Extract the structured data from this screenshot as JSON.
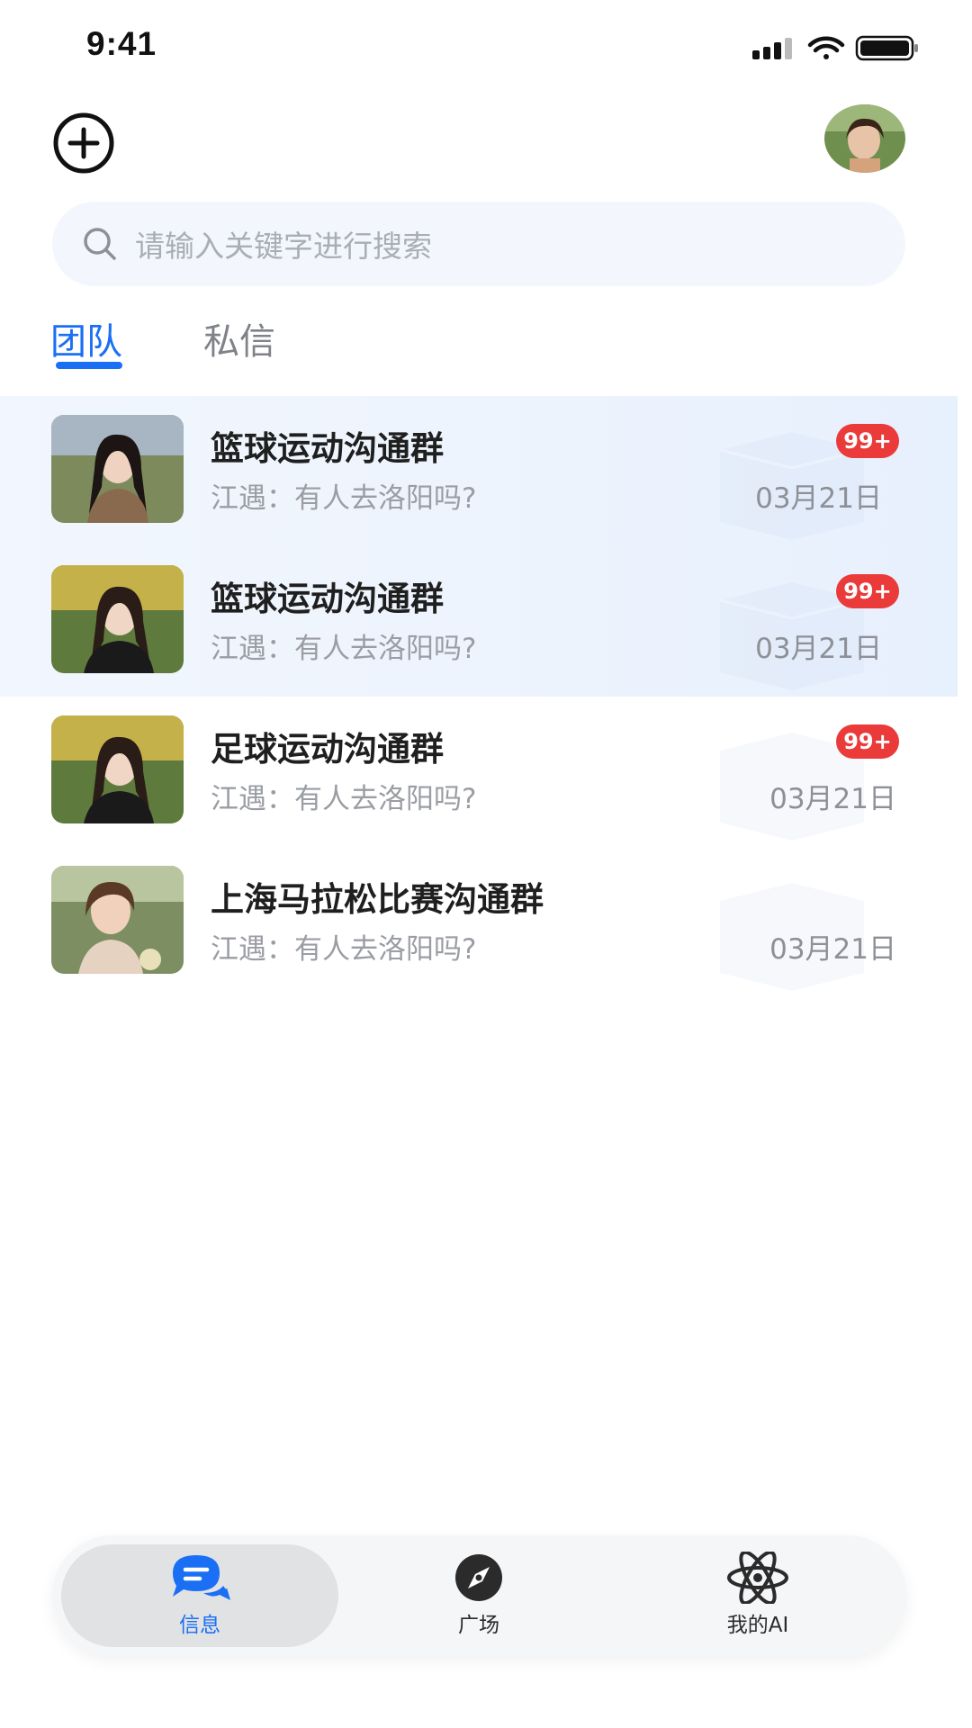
{
  "status_bar": {
    "time": "9:41"
  },
  "search": {
    "placeholder": "请输入关键字进行搜索"
  },
  "tabs": [
    {
      "label": "团队",
      "active": true
    },
    {
      "label": "私信",
      "active": false
    }
  ],
  "conversations": [
    {
      "title": "篮球运动沟通群",
      "last_message": "江遇：有人去洛阳吗?",
      "date": "03月21日",
      "badge": "99+",
      "highlighted": true
    },
    {
      "title": "篮球运动沟通群",
      "last_message": "江遇：有人去洛阳吗?",
      "date": "03月21日",
      "badge": "99+",
      "highlighted": true
    },
    {
      "title": "足球运动沟通群",
      "last_message": "江遇：有人去洛阳吗?",
      "date": "03月21日",
      "badge": "99+",
      "highlighted": false
    },
    {
      "title": "上海马拉松比赛沟通群",
      "last_message": "江遇：有人去洛阳吗?",
      "date": "03月21日",
      "badge": "",
      "highlighted": false
    }
  ],
  "bottom_nav": [
    {
      "label": "信息",
      "icon": "chat-bubble-icon",
      "active": true
    },
    {
      "label": "广场",
      "icon": "compass-icon",
      "active": false
    },
    {
      "label": "我的AI",
      "icon": "atom-icon",
      "active": false
    }
  ],
  "colors": {
    "accent": "#1b6ff5",
    "badge": "#ea3a3a",
    "search_bg": "#f3f7fd"
  }
}
